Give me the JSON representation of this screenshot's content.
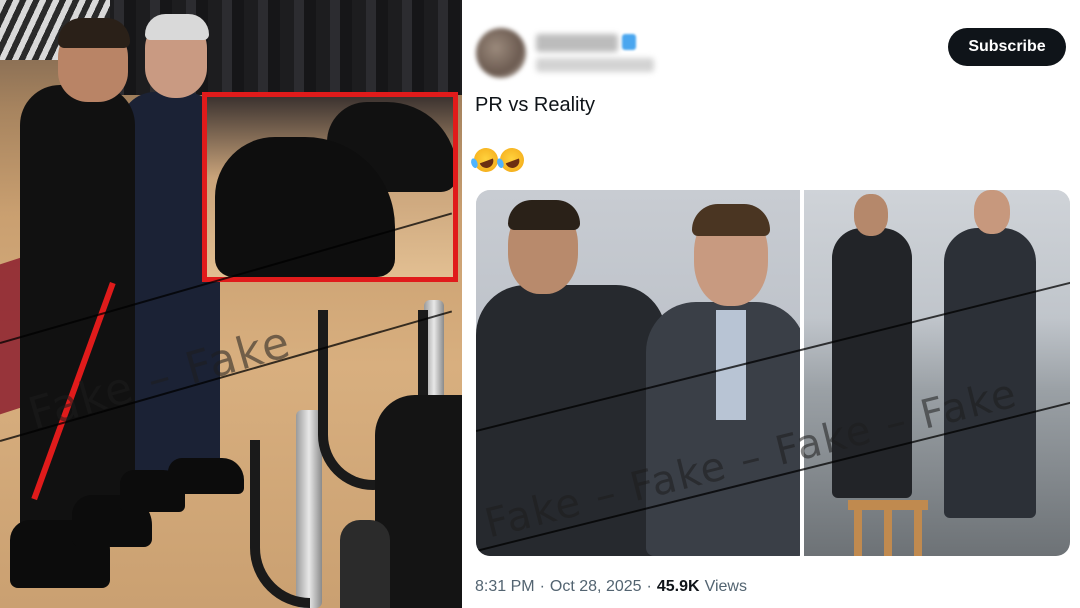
{
  "left_image": {
    "watermark_text": "Fake – Fake"
  },
  "tweet": {
    "subscribe_label": "Subscribe",
    "text": "PR vs Reality",
    "emojis": [
      "rolling-on-floor-laughing",
      "rolling-on-floor-laughing"
    ],
    "media_watermark_text": "Fake – Fake – Fake – Fake",
    "time": "8:31 PM",
    "separator": "·",
    "date": "Oct 28, 2025",
    "views_count": "45.9K",
    "views_label": "Views"
  },
  "colors": {
    "zoom_box_border": "#e01b1b",
    "subscribe_bg": "#0f1419",
    "meta_text": "#536471"
  }
}
